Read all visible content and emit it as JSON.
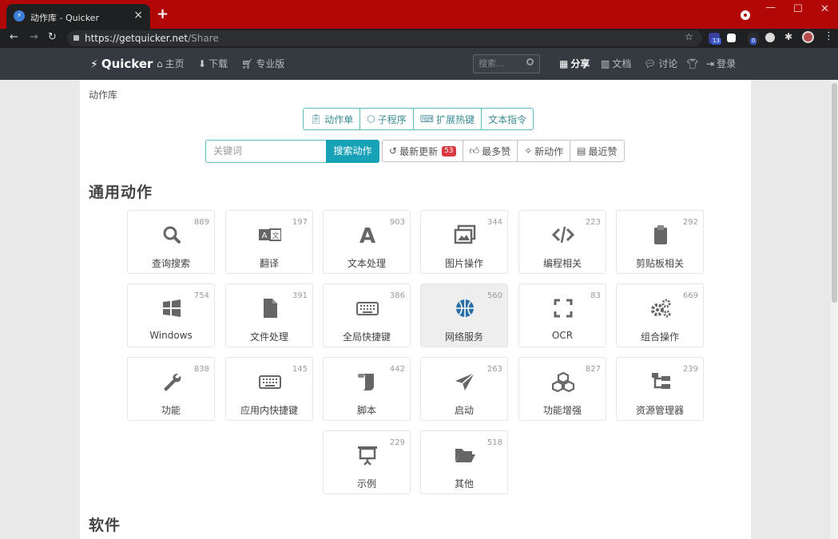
{
  "browser": {
    "tab_title": "动作库 - Quicker",
    "url_host": "https://getquicker.net",
    "url_path": "/Share",
    "ext_badges": [
      "13",
      "0"
    ]
  },
  "appnav": {
    "brand": "Quicker",
    "links": [
      {
        "label": "主页",
        "icon": "home-icon"
      },
      {
        "label": "下载",
        "icon": "download-icon"
      },
      {
        "label": "专业版",
        "icon": "cart-icon"
      }
    ],
    "search_placeholder": "搜索...",
    "right_links": [
      {
        "label": "分享",
        "icon": "grid-icon",
        "active": true
      },
      {
        "label": "文档",
        "icon": "book-icon"
      },
      {
        "label": "讨论",
        "icon": "chat-icon"
      },
      {
        "label": "",
        "icon": "shirt-icon"
      },
      {
        "label": "登录",
        "icon": "login-icon"
      }
    ]
  },
  "breadcrumb": "动作库",
  "tabs": [
    {
      "label": "动作单",
      "icon": "clipboard-icon"
    },
    {
      "label": "子程序",
      "icon": "cube-icon"
    },
    {
      "label": "扩展热键",
      "icon": "keyboard-icon"
    },
    {
      "label": "文本指令",
      "icon": ""
    }
  ],
  "search": {
    "placeholder": "关键词",
    "button": "搜索动作"
  },
  "sort_buttons": [
    {
      "label": "最新更新",
      "icon": "history-icon",
      "badge": "53"
    },
    {
      "label": "最多赞",
      "icon": "thumbs-up-icon"
    },
    {
      "label": "新动作",
      "icon": "sparkle-icon"
    },
    {
      "label": "最近赞",
      "icon": "calendar-icon"
    }
  ],
  "section_general": "通用动作",
  "section_software": "软件",
  "categories": [
    {
      "label": "查询搜索",
      "count": "889",
      "icon": "search-icon"
    },
    {
      "label": "翻译",
      "count": "197",
      "icon": "translate-icon"
    },
    {
      "label": "文本处理",
      "count": "903",
      "icon": "font-icon"
    },
    {
      "label": "图片操作",
      "count": "344",
      "icon": "images-icon"
    },
    {
      "label": "编程相关",
      "count": "223",
      "icon": "code-icon"
    },
    {
      "label": "剪贴板相关",
      "count": "292",
      "icon": "clipboard-icon"
    },
    {
      "label": "Windows",
      "count": "754",
      "icon": "windows-icon"
    },
    {
      "label": "文件处理",
      "count": "391",
      "icon": "file-icon"
    },
    {
      "label": "全局快捷键",
      "count": "386",
      "icon": "keyboard-icon"
    },
    {
      "label": "网络服务",
      "count": "560",
      "icon": "globe-icon"
    },
    {
      "label": "OCR",
      "count": "83",
      "icon": "expand-icon"
    },
    {
      "label": "组合操作",
      "count": "669",
      "icon": "cogs-icon"
    },
    {
      "label": "功能",
      "count": "838",
      "icon": "wrench-icon"
    },
    {
      "label": "应用内快捷键",
      "count": "145",
      "icon": "keyboard-icon"
    },
    {
      "label": "脚本",
      "count": "442",
      "icon": "scroll-icon"
    },
    {
      "label": "启动",
      "count": "263",
      "icon": "paper-plane-icon"
    },
    {
      "label": "功能增强",
      "count": "827",
      "icon": "cubes-icon"
    },
    {
      "label": "资源管理器",
      "count": "239",
      "icon": "sitemap-icon"
    },
    {
      "label": "示例",
      "count": "229",
      "icon": "presentation-icon"
    },
    {
      "label": "其他",
      "count": "518",
      "icon": "folder-open-icon"
    }
  ]
}
